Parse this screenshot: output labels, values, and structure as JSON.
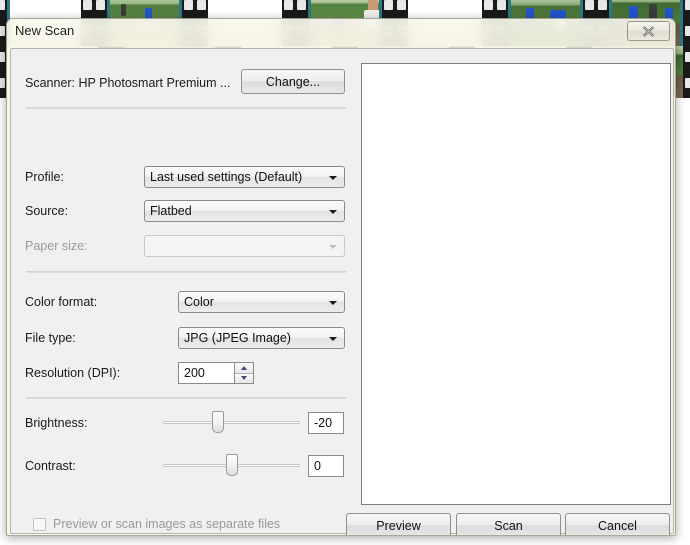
{
  "window": {
    "title": "New Scan",
    "close_icon": "close-icon"
  },
  "scanner": {
    "label": "Scanner: HP Photosmart Premium ...",
    "change_button": "Change..."
  },
  "fields": {
    "profile": {
      "label": "Profile:",
      "value": "Last used settings (Default)",
      "disabled": false
    },
    "source": {
      "label": "Source:",
      "value": "Flatbed",
      "disabled": false
    },
    "paper_size": {
      "label": "Paper size:",
      "value": "",
      "disabled": true
    },
    "color_format": {
      "label": "Color format:",
      "value": "Color",
      "disabled": false
    },
    "file_type": {
      "label": "File type:",
      "value": "JPG (JPEG Image)",
      "disabled": false
    },
    "resolution": {
      "label": "Resolution (DPI):",
      "value": "200"
    },
    "brightness": {
      "label": "Brightness:",
      "value": "-20",
      "slider_percent": 40
    },
    "contrast": {
      "label": "Contrast:",
      "value": "0",
      "slider_percent": 50
    }
  },
  "checkbox": {
    "label": "Preview or scan images as separate files",
    "checked": false,
    "disabled": true
  },
  "buttons": {
    "preview": "Preview",
    "scan": "Scan",
    "cancel": "Cancel"
  },
  "colors": {
    "dialog_glass": "#f6f5e8",
    "dialog_body": "#f0f0f0",
    "preview_background": "#ffffff",
    "disabled_text": "#999999",
    "text": "#1a1a1a",
    "border": "#888a8c"
  }
}
